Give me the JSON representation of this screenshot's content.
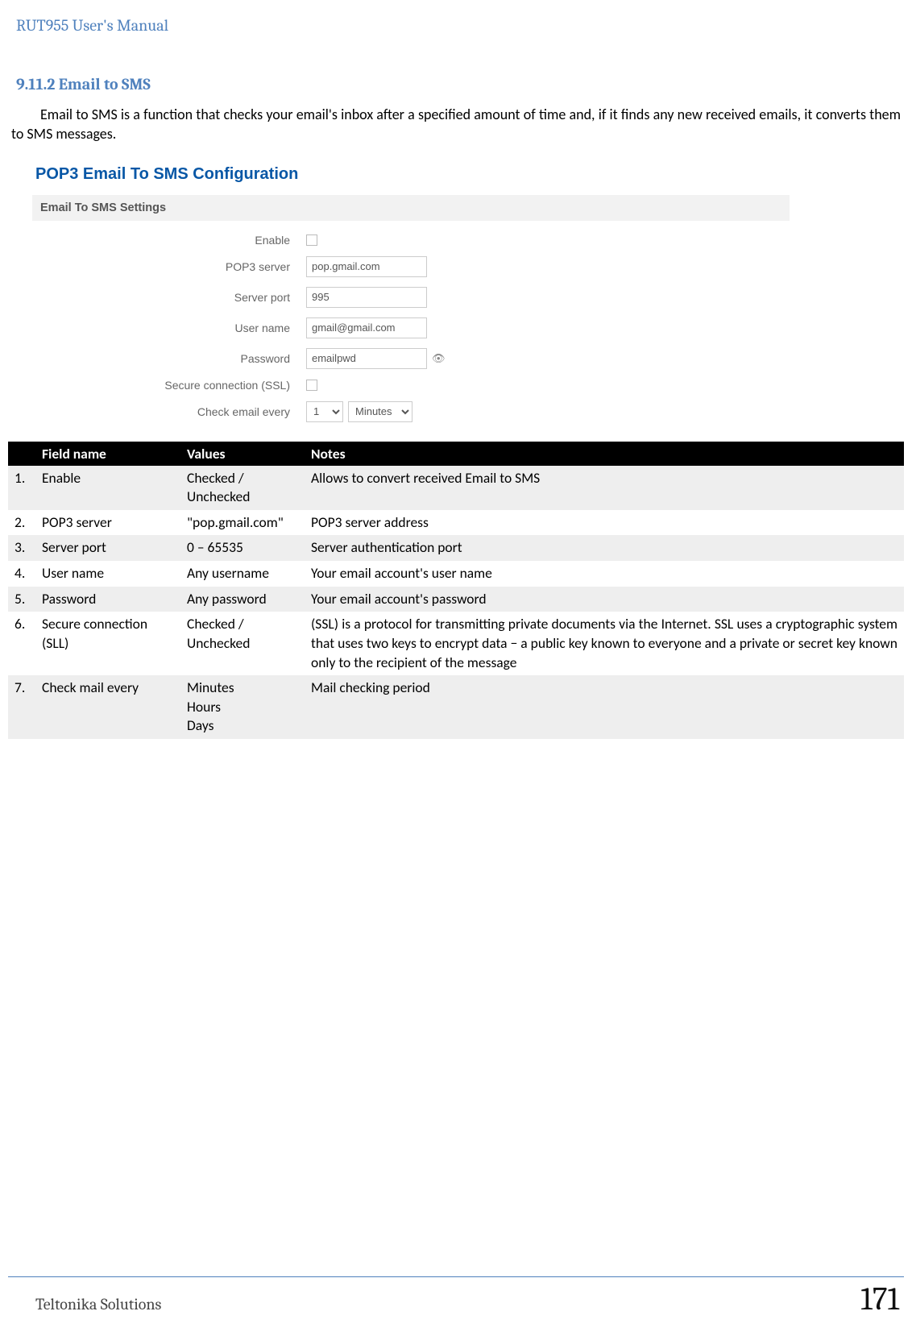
{
  "header": {
    "title": "RUT955 User's Manual"
  },
  "section": {
    "number": "9.11.2",
    "title": "Email to SMS",
    "heading_full": "9.11.2 Email to SMS",
    "intro": "Email to SMS is a function that checks your email's inbox after a specified amount of time and, if it finds any new received emails, it converts them to SMS messages."
  },
  "config": {
    "title": "POP3 Email To SMS Configuration",
    "sub": "Email To SMS Settings",
    "labels": {
      "enable": "Enable",
      "pop3": "POP3 server",
      "port": "Server port",
      "user": "User name",
      "pass": "Password",
      "ssl": "Secure connection (SSL)",
      "check": "Check email every"
    },
    "values": {
      "pop3": "pop.gmail.com",
      "port": "995",
      "user": "gmail@gmail.com",
      "pass": "emailpwd",
      "check_num": "1",
      "check_unit": "Minutes"
    }
  },
  "table": {
    "head": {
      "c1": "",
      "c2": "Field name",
      "c3": "Values",
      "c4": "Notes"
    },
    "rows": [
      {
        "n": "1.",
        "name": "Enable",
        "val": "Checked / Unchecked",
        "notes": "Allows to convert received Email to SMS"
      },
      {
        "n": "2.",
        "name": "POP3 server",
        "val": "\"pop.gmail.com\"",
        "notes": "POP3 server address"
      },
      {
        "n": "3.",
        "name": "Server port",
        "val": "0 – 65535",
        "notes": "Server authentication port"
      },
      {
        "n": "4.",
        "name": "User name",
        "val": "Any username",
        "notes": "Your email account's user name"
      },
      {
        "n": "5.",
        "name": "Password",
        "val": "Any password",
        "notes": "Your email account's password"
      },
      {
        "n": "6.",
        "name": "Secure connection (SLL)",
        "val": "Checked / Unchecked",
        "notes": "(SSL) is a protocol for transmitting private documents via the Internet. SSL uses a cryptographic system that uses two keys to encrypt data − a public key known to everyone and a private or secret key known only to the recipient of the message"
      },
      {
        "n": "7.",
        "name": "Check mail every",
        "val": "Minutes\nHours\nDays",
        "notes": "Mail checking period"
      }
    ]
  },
  "footer": {
    "left": "Teltonika Solutions",
    "page": "171"
  }
}
